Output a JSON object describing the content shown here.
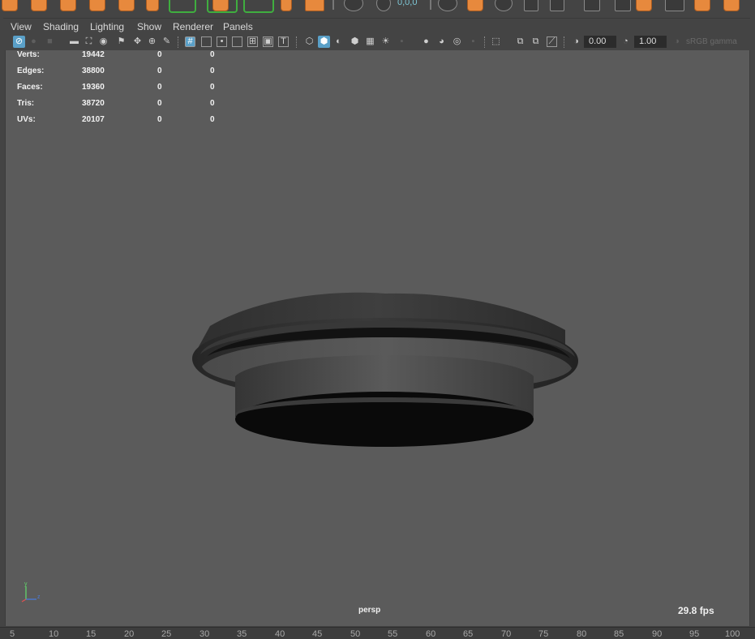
{
  "shelf": {
    "readout": "0,0,0"
  },
  "menu": {
    "items": [
      "View",
      "Shading",
      "Lighting",
      "Show",
      "Renderer",
      "Panels"
    ]
  },
  "toolbar": {
    "exposure_value": "0.00",
    "gamma_value": "1.00",
    "color_space_label": "sRGB gamma"
  },
  "hud": {
    "rows": [
      {
        "label": "Verts:",
        "total": "19442",
        "selected": "0",
        "uv": "0"
      },
      {
        "label": "Edges:",
        "total": "38800",
        "selected": "0",
        "uv": "0"
      },
      {
        "label": "Faces:",
        "total": "19360",
        "selected": "0",
        "uv": "0"
      },
      {
        "label": "Tris:",
        "total": "38720",
        "selected": "0",
        "uv": "0"
      },
      {
        "label": "UVs:",
        "total": "20107",
        "selected": "0",
        "uv": "0"
      }
    ]
  },
  "viewport": {
    "camera": "persp",
    "fps": "29.8 fps",
    "axis_labels": [
      "y",
      "z"
    ]
  },
  "timeline": {
    "ticks": [
      "5",
      "10",
      "15",
      "20",
      "25",
      "30",
      "35",
      "40",
      "45",
      "50",
      "55",
      "60",
      "65",
      "70",
      "75",
      "80",
      "85",
      "90",
      "95",
      "100"
    ]
  },
  "colors": {
    "viewport_bg": "#5b5b5b",
    "ui_bg": "#444444",
    "accent_blue": "#5aa0c8",
    "shelf_orange": "#e7893d"
  }
}
